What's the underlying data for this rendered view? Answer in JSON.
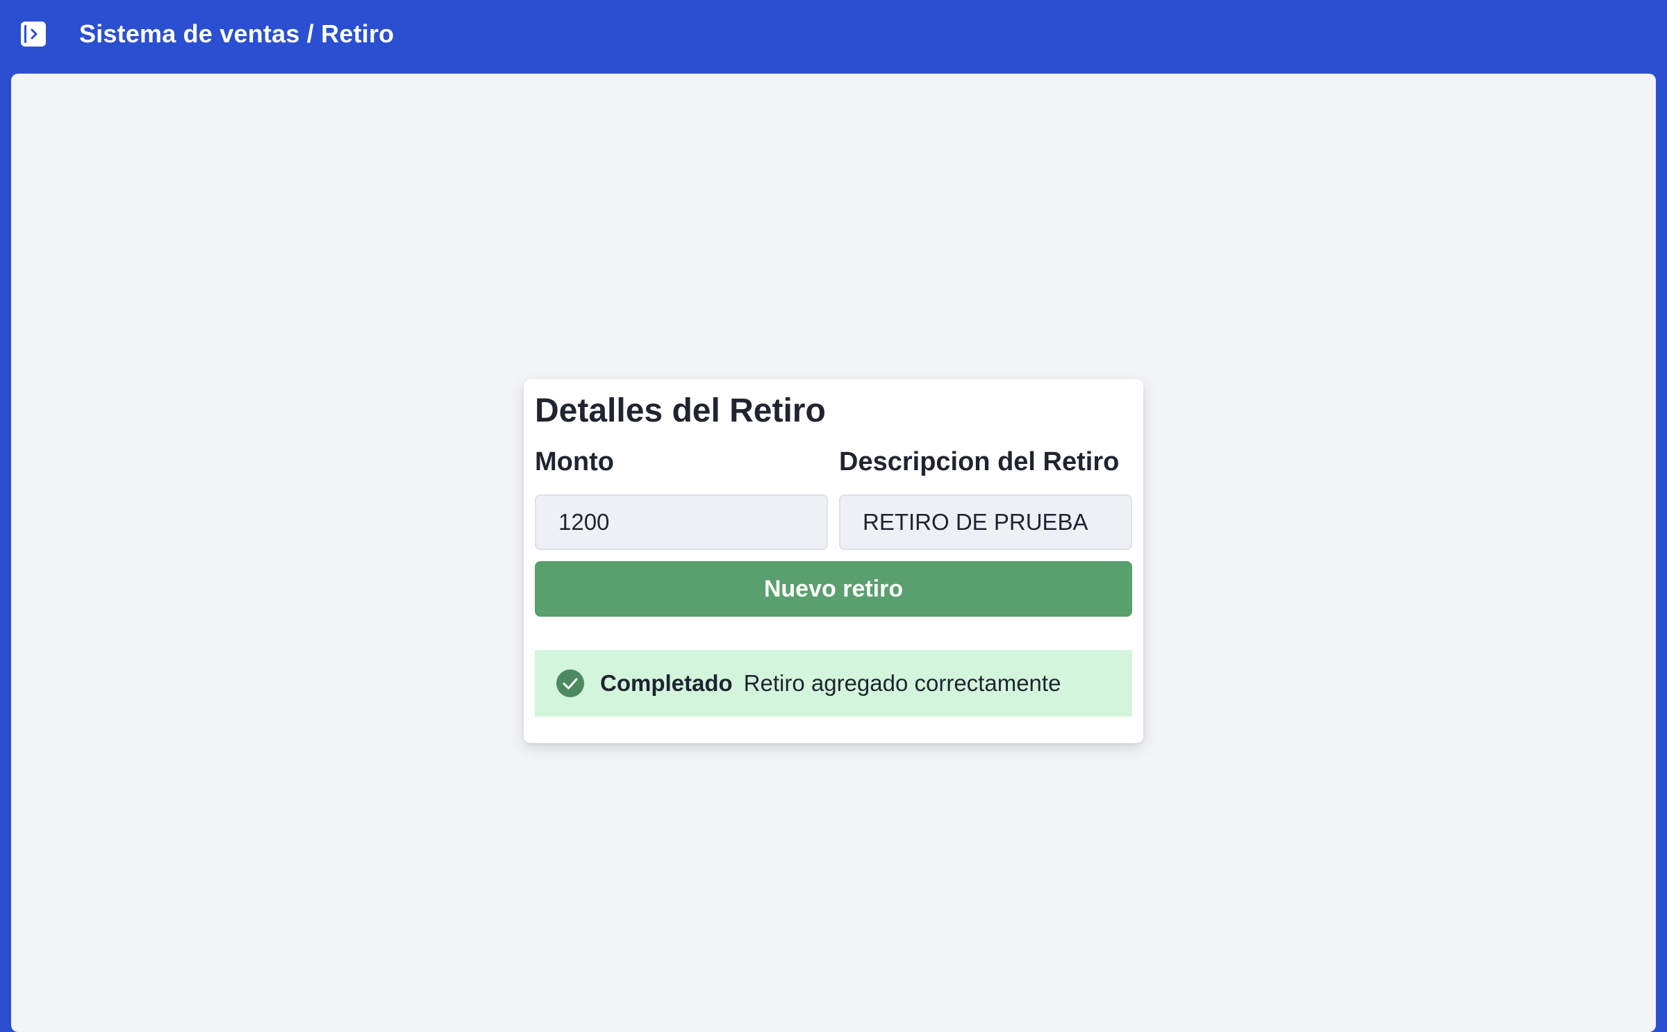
{
  "header": {
    "title": "Sistema de ventas / Retiro",
    "toggle_icon": "sidebar-toggle-icon",
    "background_color": "#2b4fd1"
  },
  "form": {
    "title": "Detalles del Retiro",
    "amount_label": "Monto",
    "amount_value": "1200",
    "description_label": "Descripcion del Retiro",
    "description_value": "RETIRO DE PRUEBA",
    "submit_label": "Nuevo retiro",
    "button_color": "#5a9f6e"
  },
  "alert": {
    "icon": "check-circle-icon",
    "title": "Completado",
    "message": "Retiro agregado correctamente",
    "background_color": "#d2f5dc",
    "icon_color": "#4b8a5e"
  }
}
